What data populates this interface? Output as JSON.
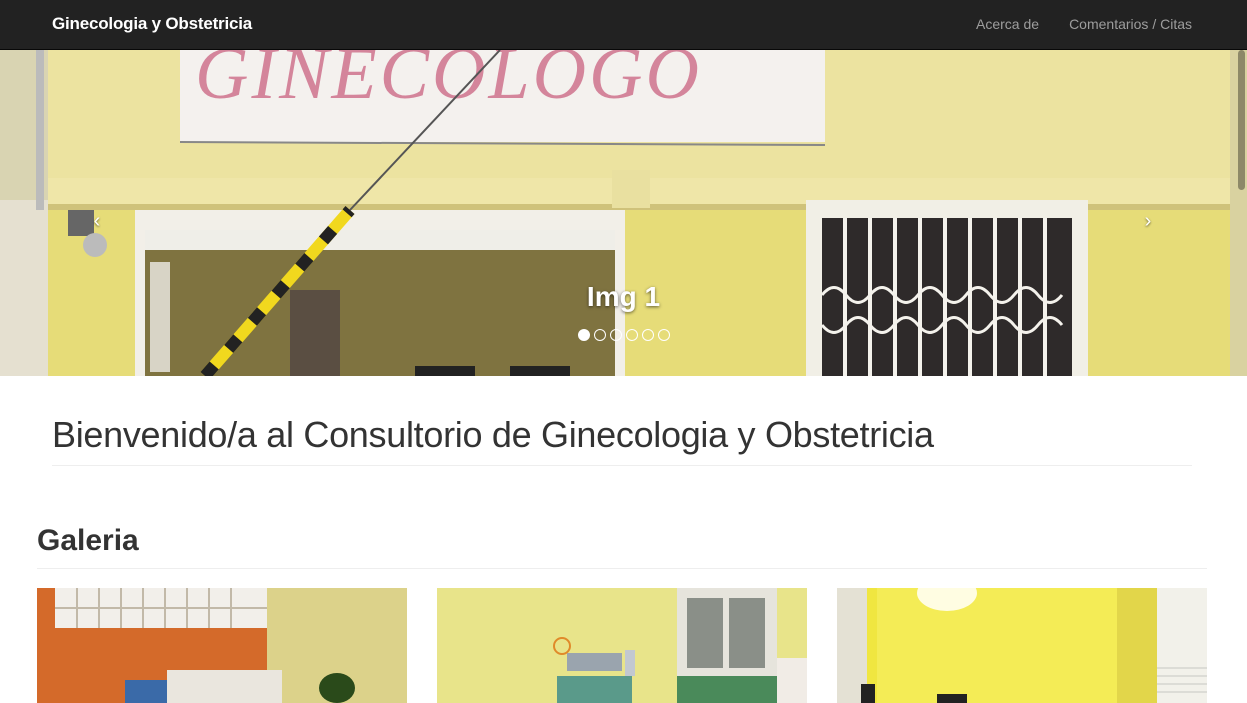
{
  "navbar": {
    "brand": "Ginecologia y Obstetricia",
    "links": [
      "Acerca de",
      "Comentarios / Citas"
    ]
  },
  "carousel": {
    "sign_text": "GINECOLOGO",
    "caption": "Img 1",
    "slide_count": 6,
    "active_index": 0,
    "prev_icon": "chevron-left-icon",
    "next_icon": "chevron-right-icon"
  },
  "main": {
    "welcome_title": "Bienvenido/a al Consultorio de Ginecologia y Obstetricia",
    "gallery_title": "Galeria",
    "gallery_images": [
      "exam-room-orange-wall",
      "medical-equipment-room",
      "yellow-hallway"
    ]
  },
  "colors": {
    "navbar_bg": "#222222",
    "nav_link": "#9d9d9d",
    "wall_yellow": "#e8df7a",
    "sign_text": "#d4859b"
  }
}
